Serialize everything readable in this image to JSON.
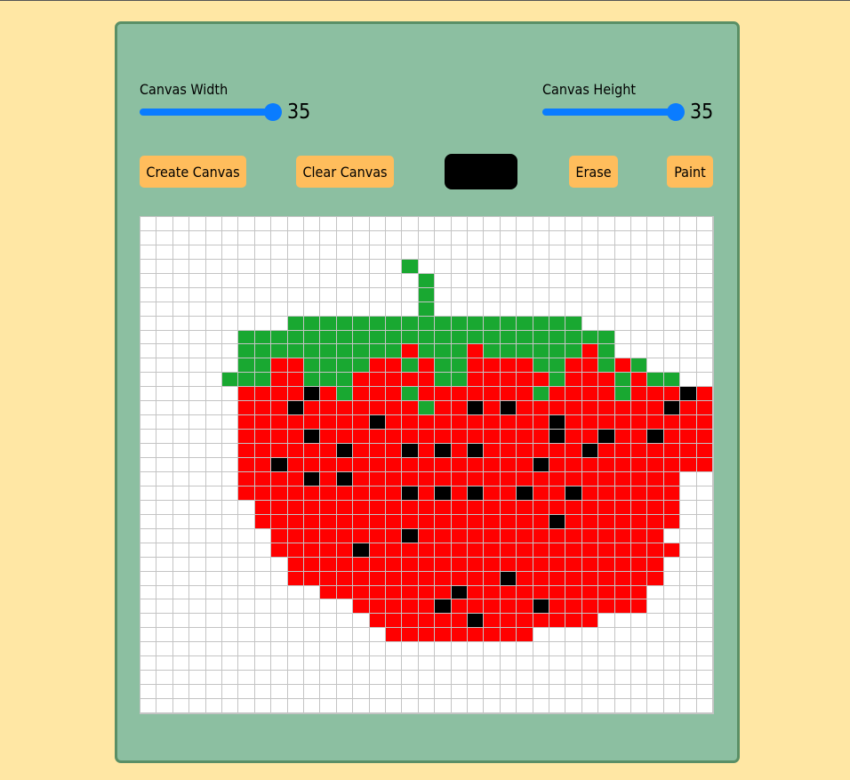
{
  "controls": {
    "width_label": "Canvas Width",
    "width_value": "35",
    "width_min": 1,
    "width_max": 35,
    "height_label": "Canvas Height",
    "height_value": "35",
    "height_min": 1,
    "height_max": 35
  },
  "buttons": {
    "create": "Create Canvas",
    "clear": "Clear Canvas",
    "erase": "Erase",
    "paint": "Paint"
  },
  "color_picker": {
    "value": "#000000"
  },
  "canvas": {
    "cols": 35,
    "rows": 35,
    "palette": {
      "G": "#19a831",
      "R": "#ff0000",
      "K": "#000000",
      ".": "#ffffff"
    },
    "pixels": [
      "...................................",
      "...................................",
      "...................................",
      "................G..................",
      ".................G.................",
      ".................G.................",
      ".................G.................",
      ".........GGGGGGGGGGGGGGGGGG........",
      "......GGGGGGGGGGGGGGGGGGGGGGG......",
      "......GGGGGGGGGGRGGGRGGGGGGRG......",
      "......GGRRGGGGRRGRGGRRRRGGRRGRG....",
      ".....GGGRRGGGRRRRRGGRRRRRGRRRGRGG..",
      "......RRRRKRGRRRGRRRRRRRGRRRRGRRRKR",
      "......RRRKRRRRRRRGRRKRKRRRRRRRRRKRR",
      "......RRRRRRRRKRRRRRRRRRRKRRRRRRRRR",
      "......RRRRKRRRRRRRRRRRRRRKRRKRRKRRR",
      "......RRRRRRKRRRKRKRKRRRRRRKRRRRRRR",
      "......RRKRRRRRRRRRRRRRRRKRRRRRRRRRR",
      "......RRRRKRKRRRRRRRRRRRRRRRRRRRR..",
      "......RRRRRRRRRRKRKRKRRKRRKRRRRRR..",
      ".......RRRRRRRRRRRRRRRRRRRRRRRRRR..",
      ".......RRRRRRRRRRRRRRRRRRKRRRRRRR..",
      "........RRRRRRRRKRRRRRRRRRRRRRRR...",
      "........RRRRRKRRRRRRRRRRRRRRRRRRR..",
      ".........RRRRRRRRRRRRRRRRRRRRRRR...",
      ".........RRRRRRRRRRRRRKRRRRRRRRR...",
      "...........RRRRRRRRKRRRRRRRRRRR....",
      ".............RRRRRKRRRRRKRRRRRR....",
      "..............RRRRRRKRRRRRRR.......",
      "...............RRRRRRRRR...........",
      "...................................",
      "...................................",
      "...................................",
      "...................................",
      "..................................."
    ]
  }
}
